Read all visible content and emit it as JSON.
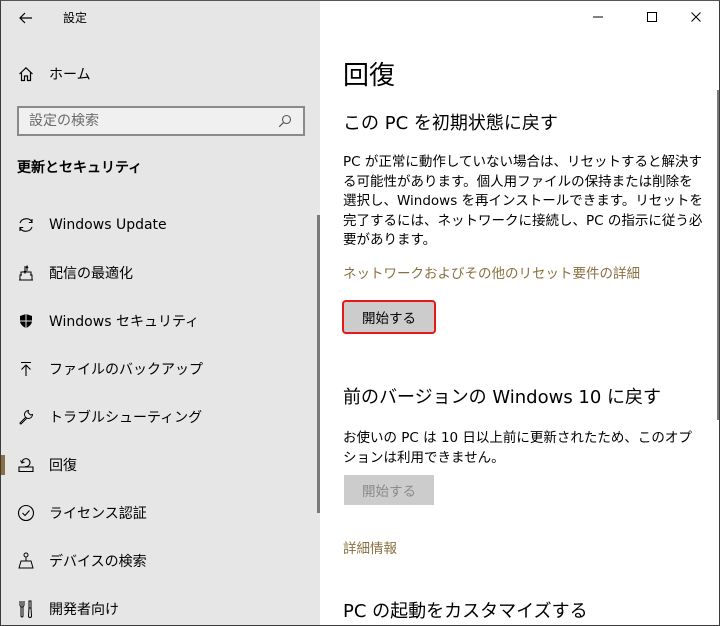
{
  "window": {
    "title": "設定",
    "controls": {
      "minimize": "minimize-icon",
      "maximize": "maximize-icon",
      "close": "close-icon"
    }
  },
  "sidebar": {
    "home_label": "ホーム",
    "search": {
      "placeholder": "設定の検索",
      "value": ""
    },
    "section_title": "更新とセキュリティ",
    "items": [
      {
        "label": "Windows Update",
        "icon": "sync-icon",
        "selected": false
      },
      {
        "label": "配信の最適化",
        "icon": "delivery-optimization-icon",
        "selected": false
      },
      {
        "label": "Windows セキュリティ",
        "icon": "shield-icon",
        "selected": false
      },
      {
        "label": "ファイルのバックアップ",
        "icon": "upload-arrow-icon",
        "selected": false
      },
      {
        "label": "トラブルシューティング",
        "icon": "wrench-icon",
        "selected": false
      },
      {
        "label": "回復",
        "icon": "recovery-icon",
        "selected": true
      },
      {
        "label": "ライセンス認証",
        "icon": "check-circle-icon",
        "selected": false
      },
      {
        "label": "デバイスの検索",
        "icon": "find-device-icon",
        "selected": false
      },
      {
        "label": "開発者向け",
        "icon": "developer-tools-icon",
        "selected": false
      }
    ]
  },
  "main": {
    "title": "回復",
    "reset": {
      "heading": "この PC を初期状態に戻す",
      "description": "PC が正常に動作していない場合は、リセットすると解決する可能性があります。個人用ファイルの保持または削除を選択し、Windows を再インストールできます。リセットを完了するには、ネットワークに接続し、PC の指示に従う必要があります。",
      "link": "ネットワークおよびその他のリセット要件の詳細",
      "button": "開始する"
    },
    "rollback": {
      "heading": "前のバージョンの Windows 10 に戻す",
      "description": "お使いの PC は 10 日以上前に更新されたため、このオプションは利用できません。",
      "button": "開始する",
      "button_disabled": true,
      "link": "詳細情報"
    },
    "startup": {
      "heading": "PC の起動をカスタマイズする"
    }
  },
  "colors": {
    "accent": "#8a7040",
    "highlight_border": "#e81818",
    "sidebar_bg": "#e6e6e6"
  }
}
